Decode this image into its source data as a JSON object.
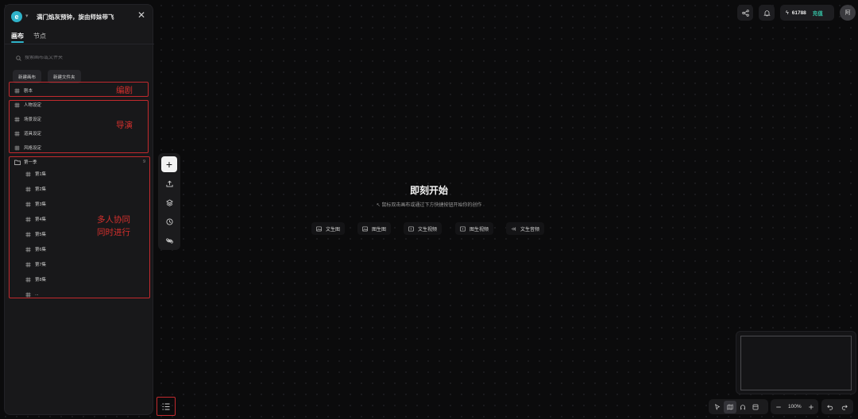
{
  "panel": {
    "logo_letter": "e",
    "title": "满门焰灰预钟，旋由师妹带飞",
    "tabs": [
      "画布",
      "节点"
    ],
    "search_placeholder": "搜索画布或文件夹",
    "new_canvas": "新建画布",
    "new_folder": "新建文件夹",
    "items_top": [
      "剧本"
    ],
    "items_director": [
      "人物设定",
      "场景设定",
      "道具设定",
      "风格设定"
    ],
    "folder": {
      "label": "第一季",
      "count": "9"
    },
    "episodes": [
      "第1集",
      "第2集",
      "第3集",
      "第4集",
      "第5集",
      "第6集",
      "第7集",
      "第8集",
      "..."
    ]
  },
  "annotations": {
    "script": "编剧",
    "director": "导演",
    "collab_line1": "多人协同",
    "collab_line2": "同时进行"
  },
  "canvas": {
    "title": "即刻开始",
    "subtitle": "鼠标双击画布或通过下方快捷按钮开始你的创作",
    "quick_actions": [
      "文生图",
      "图生图",
      "文生视频",
      "图生视频",
      "文生音频"
    ]
  },
  "topbar": {
    "credits": "61788",
    "recharge": "充值",
    "avatar": "阿"
  },
  "zoom": {
    "level": "100%"
  },
  "colors": {
    "accent": "#2fb3c9",
    "recharge": "#35c3a6",
    "annotation_red": "#d6302d"
  }
}
